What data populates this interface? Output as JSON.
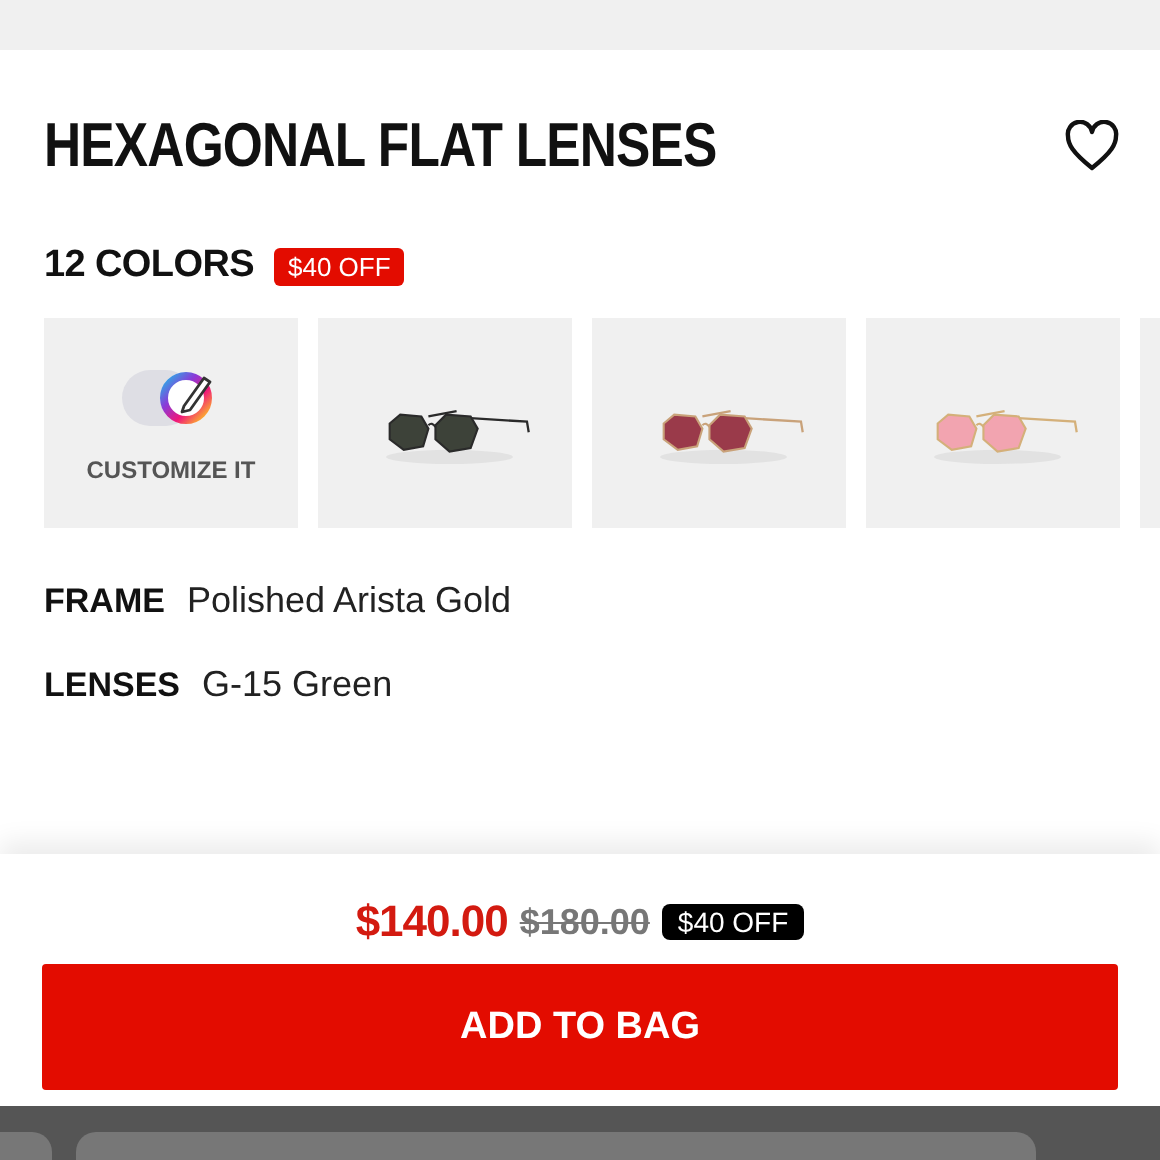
{
  "product": {
    "title": "HEXAGONAL FLAT LENSES",
    "colors_count": "12 COLORS",
    "discount_badge": "$40 OFF"
  },
  "swatches": [
    {
      "kind": "customize",
      "label": "CUSTOMIZE IT"
    },
    {
      "kind": "picture"
    },
    {
      "kind": "picture"
    },
    {
      "kind": "picture"
    },
    {
      "kind": "partial"
    }
  ],
  "specs": [
    {
      "label": "FRAME",
      "value": "Polished Arista Gold"
    },
    {
      "label": "LENSES",
      "value": "G-15 Green"
    }
  ],
  "purchase": {
    "price": "$140.00",
    "original_price": "$180.00",
    "discount_badge": "$40 OFF",
    "button": "ADD TO BAG"
  }
}
